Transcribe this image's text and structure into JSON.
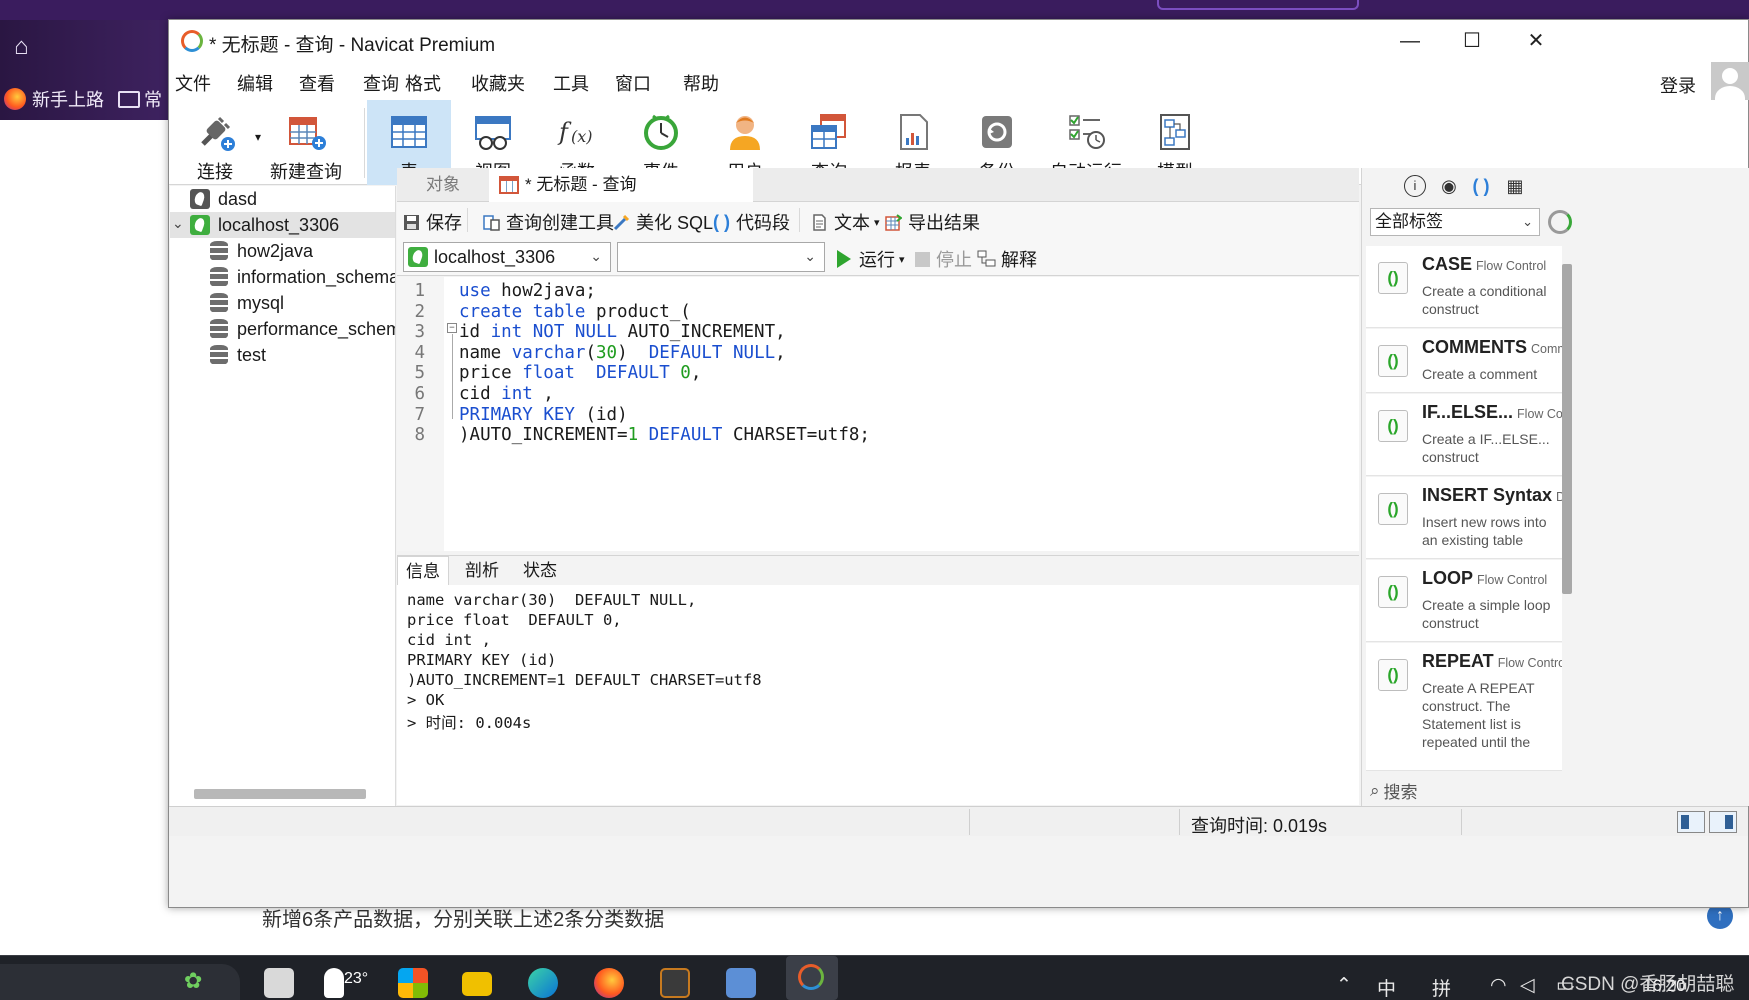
{
  "background": {
    "bookmarks": [
      "新手上路",
      "常"
    ],
    "caption": "新增6条产品数据，分别关联上述2条分类数据"
  },
  "window": {
    "title": "* 无标题 - 查询 - Navicat Premium",
    "menu": [
      "文件",
      "编辑",
      "查看",
      "查询",
      "格式",
      "收藏夹",
      "工具",
      "窗口",
      "帮助"
    ],
    "login": "登录"
  },
  "toolbar": [
    {
      "label": "连接",
      "icon": "plug-icon"
    },
    {
      "label": "新建查询",
      "icon": "new-query-icon"
    },
    {
      "label": "表",
      "icon": "table-icon",
      "active": true
    },
    {
      "label": "视图",
      "icon": "view-icon"
    },
    {
      "label": "函数",
      "icon": "function-icon"
    },
    {
      "label": "事件",
      "icon": "clock-icon"
    },
    {
      "label": "用户",
      "icon": "user-icon"
    },
    {
      "label": "查询",
      "icon": "query-icon"
    },
    {
      "label": "报表",
      "icon": "report-icon"
    },
    {
      "label": "备份",
      "icon": "backup-icon"
    },
    {
      "label": "自动运行",
      "icon": "automation-icon"
    },
    {
      "label": "模型",
      "icon": "model-icon"
    }
  ],
  "tree": {
    "connections": [
      {
        "name": "dasd",
        "expanded": false
      },
      {
        "name": "localhost_3306",
        "expanded": true,
        "selected": true
      }
    ],
    "databases": [
      "how2java",
      "information_schema",
      "mysql",
      "performance_schema",
      "test"
    ]
  },
  "tabs": {
    "objects": "对象",
    "query": "* 无标题 - 查询"
  },
  "editor_toolbar": {
    "save": "保存",
    "query_builder": "查询创建工具",
    "beautify": "美化 SQL",
    "snippet": "代码段",
    "text": "文本",
    "export": "导出结果"
  },
  "run_bar": {
    "connection": "localhost_3306",
    "database": "",
    "run": "运行",
    "stop": "停止",
    "explain": "解释"
  },
  "code_lines": [
    "use how2java;",
    "create table product_(",
    "id int NOT NULL AUTO_INCREMENT,",
    "name varchar(30)  DEFAULT NULL,",
    "price float  DEFAULT 0,",
    "cid int ,",
    "PRIMARY KEY (id)",
    ")AUTO_INCREMENT=1 DEFAULT CHARSET=utf8;"
  ],
  "result_tabs": [
    "信息",
    "剖析",
    "状态"
  ],
  "result_lines": [
    "name varchar(30)  DEFAULT NULL,",
    "price float  DEFAULT 0,",
    "cid int ,",
    "PRIMARY KEY (id)",
    ")AUTO_INCREMENT=1 DEFAULT CHARSET=utf8",
    "> OK",
    "> 时间: 0.004s"
  ],
  "right_panel": {
    "filter": "全部标签",
    "search": "搜索",
    "snippets": [
      {
        "name": "CASE",
        "type": "Flow Control",
        "desc": "Create a conditional construct"
      },
      {
        "name": "COMMENTS",
        "type": "Comm",
        "desc": "Create a comment"
      },
      {
        "name": "IF...ELSE...",
        "type": "Flow Contr",
        "desc": "Create a IF...ELSE... construct"
      },
      {
        "name": "INSERT Syntax",
        "type": "DM",
        "desc": "Insert new rows into an existing table"
      },
      {
        "name": "LOOP",
        "type": "Flow Control",
        "desc": "Create a simple loop construct"
      },
      {
        "name": "REPEAT",
        "type": "Flow Control",
        "desc": "Create A REPEAT construct. The Statement list is repeated until the"
      }
    ]
  },
  "status": {
    "query_time": "查询时间: 0.019s"
  },
  "taskbar": {
    "weather": "23°",
    "ime1": "中",
    "ime2": "拼",
    "clock": "16:20",
    "watermark": "CSDN @香肠胡喆聪"
  }
}
